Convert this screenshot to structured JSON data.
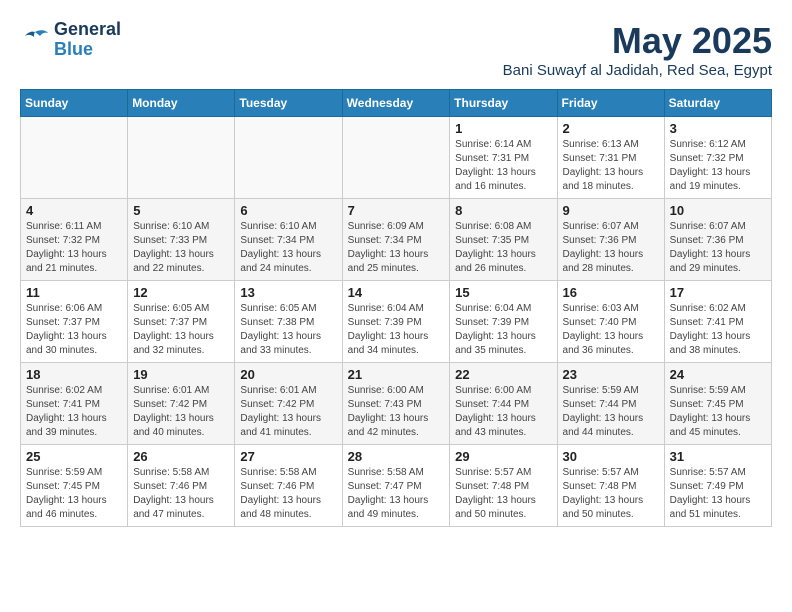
{
  "header": {
    "logo_line1": "General",
    "logo_line2": "Blue",
    "month_title": "May 2025",
    "subtitle": "Bani Suwayf al Jadidah, Red Sea, Egypt"
  },
  "weekdays": [
    "Sunday",
    "Monday",
    "Tuesday",
    "Wednesday",
    "Thursday",
    "Friday",
    "Saturday"
  ],
  "weeks": [
    [
      {
        "day": "",
        "info": ""
      },
      {
        "day": "",
        "info": ""
      },
      {
        "day": "",
        "info": ""
      },
      {
        "day": "",
        "info": ""
      },
      {
        "day": "1",
        "info": "Sunrise: 6:14 AM\nSunset: 7:31 PM\nDaylight: 13 hours\nand 16 minutes."
      },
      {
        "day": "2",
        "info": "Sunrise: 6:13 AM\nSunset: 7:31 PM\nDaylight: 13 hours\nand 18 minutes."
      },
      {
        "day": "3",
        "info": "Sunrise: 6:12 AM\nSunset: 7:32 PM\nDaylight: 13 hours\nand 19 minutes."
      }
    ],
    [
      {
        "day": "4",
        "info": "Sunrise: 6:11 AM\nSunset: 7:32 PM\nDaylight: 13 hours\nand 21 minutes."
      },
      {
        "day": "5",
        "info": "Sunrise: 6:10 AM\nSunset: 7:33 PM\nDaylight: 13 hours\nand 22 minutes."
      },
      {
        "day": "6",
        "info": "Sunrise: 6:10 AM\nSunset: 7:34 PM\nDaylight: 13 hours\nand 24 minutes."
      },
      {
        "day": "7",
        "info": "Sunrise: 6:09 AM\nSunset: 7:34 PM\nDaylight: 13 hours\nand 25 minutes."
      },
      {
        "day": "8",
        "info": "Sunrise: 6:08 AM\nSunset: 7:35 PM\nDaylight: 13 hours\nand 26 minutes."
      },
      {
        "day": "9",
        "info": "Sunrise: 6:07 AM\nSunset: 7:36 PM\nDaylight: 13 hours\nand 28 minutes."
      },
      {
        "day": "10",
        "info": "Sunrise: 6:07 AM\nSunset: 7:36 PM\nDaylight: 13 hours\nand 29 minutes."
      }
    ],
    [
      {
        "day": "11",
        "info": "Sunrise: 6:06 AM\nSunset: 7:37 PM\nDaylight: 13 hours\nand 30 minutes."
      },
      {
        "day": "12",
        "info": "Sunrise: 6:05 AM\nSunset: 7:37 PM\nDaylight: 13 hours\nand 32 minutes."
      },
      {
        "day": "13",
        "info": "Sunrise: 6:05 AM\nSunset: 7:38 PM\nDaylight: 13 hours\nand 33 minutes."
      },
      {
        "day": "14",
        "info": "Sunrise: 6:04 AM\nSunset: 7:39 PM\nDaylight: 13 hours\nand 34 minutes."
      },
      {
        "day": "15",
        "info": "Sunrise: 6:04 AM\nSunset: 7:39 PM\nDaylight: 13 hours\nand 35 minutes."
      },
      {
        "day": "16",
        "info": "Sunrise: 6:03 AM\nSunset: 7:40 PM\nDaylight: 13 hours\nand 36 minutes."
      },
      {
        "day": "17",
        "info": "Sunrise: 6:02 AM\nSunset: 7:41 PM\nDaylight: 13 hours\nand 38 minutes."
      }
    ],
    [
      {
        "day": "18",
        "info": "Sunrise: 6:02 AM\nSunset: 7:41 PM\nDaylight: 13 hours\nand 39 minutes."
      },
      {
        "day": "19",
        "info": "Sunrise: 6:01 AM\nSunset: 7:42 PM\nDaylight: 13 hours\nand 40 minutes."
      },
      {
        "day": "20",
        "info": "Sunrise: 6:01 AM\nSunset: 7:42 PM\nDaylight: 13 hours\nand 41 minutes."
      },
      {
        "day": "21",
        "info": "Sunrise: 6:00 AM\nSunset: 7:43 PM\nDaylight: 13 hours\nand 42 minutes."
      },
      {
        "day": "22",
        "info": "Sunrise: 6:00 AM\nSunset: 7:44 PM\nDaylight: 13 hours\nand 43 minutes."
      },
      {
        "day": "23",
        "info": "Sunrise: 5:59 AM\nSunset: 7:44 PM\nDaylight: 13 hours\nand 44 minutes."
      },
      {
        "day": "24",
        "info": "Sunrise: 5:59 AM\nSunset: 7:45 PM\nDaylight: 13 hours\nand 45 minutes."
      }
    ],
    [
      {
        "day": "25",
        "info": "Sunrise: 5:59 AM\nSunset: 7:45 PM\nDaylight: 13 hours\nand 46 minutes."
      },
      {
        "day": "26",
        "info": "Sunrise: 5:58 AM\nSunset: 7:46 PM\nDaylight: 13 hours\nand 47 minutes."
      },
      {
        "day": "27",
        "info": "Sunrise: 5:58 AM\nSunset: 7:46 PM\nDaylight: 13 hours\nand 48 minutes."
      },
      {
        "day": "28",
        "info": "Sunrise: 5:58 AM\nSunset: 7:47 PM\nDaylight: 13 hours\nand 49 minutes."
      },
      {
        "day": "29",
        "info": "Sunrise: 5:57 AM\nSunset: 7:48 PM\nDaylight: 13 hours\nand 50 minutes."
      },
      {
        "day": "30",
        "info": "Sunrise: 5:57 AM\nSunset: 7:48 PM\nDaylight: 13 hours\nand 50 minutes."
      },
      {
        "day": "31",
        "info": "Sunrise: 5:57 AM\nSunset: 7:49 PM\nDaylight: 13 hours\nand 51 minutes."
      }
    ]
  ]
}
